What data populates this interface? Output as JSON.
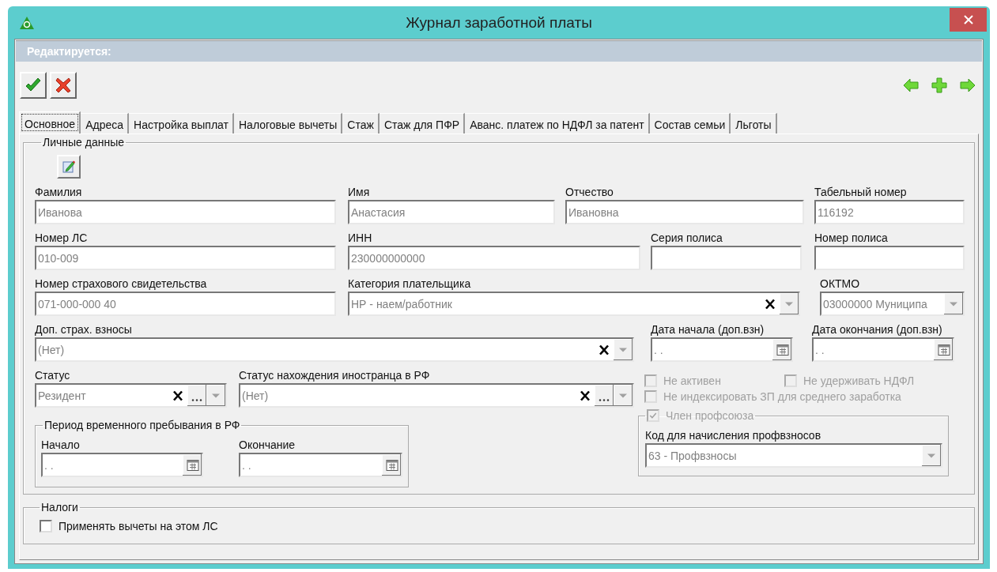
{
  "window": {
    "title": "Журнал заработной платы"
  },
  "edit_bar": {
    "label": "Редактируется:"
  },
  "tabs": [
    {
      "label": "Основное",
      "selected": true
    },
    {
      "label": "Адреса",
      "selected": false
    },
    {
      "label": "Настройка выплат",
      "selected": false
    },
    {
      "label": "Налоговые вычеты",
      "selected": false
    },
    {
      "label": "Стаж",
      "selected": false
    },
    {
      "label": "Стаж для ПФР",
      "selected": false
    },
    {
      "label": "Аванс. платеж по НДФЛ за патент",
      "selected": false
    },
    {
      "label": "Состав семьи",
      "selected": false
    },
    {
      "label": "Льготы",
      "selected": false
    }
  ],
  "personal": {
    "legend": "Личные данные",
    "fields": [
      {
        "label": "Фамилия",
        "value": "Иванова",
        "kind": "text"
      },
      {
        "label": "Имя",
        "value": "Анастасия",
        "kind": "text"
      },
      {
        "label": "Отчество",
        "value": "Ивановна",
        "kind": "text"
      },
      {
        "label": "Табельный номер",
        "value": "116192",
        "kind": "text"
      },
      {
        "label": "Номер ЛС",
        "value": "010-009",
        "kind": "text"
      },
      {
        "label": "ИНН",
        "value": "230000000000",
        "kind": "text"
      },
      {
        "label": "Серия полиса",
        "kind": "text"
      },
      {
        "label": "Номер полиса",
        "kind": "text"
      },
      {
        "label": "Номер страхового свидетельства",
        "value": "071-000-000 40",
        "kind": "text"
      },
      {
        "label": "Категория плательщика",
        "value": "НР - наем/работник",
        "kind": "combo",
        "clear": true,
        "ellipsis": false
      },
      {
        "label": "ОКТМО",
        "value": "03000000 Муниципа",
        "kind": "combo",
        "clear": false,
        "ellipsis": false
      },
      {
        "label": "Доп. страх. взносы",
        "value": "(Нет)",
        "kind": "combo",
        "clear": true,
        "ellipsis": false
      },
      {
        "label": "Дата начала (доп.взн)",
        "value": ". .",
        "kind": "date"
      },
      {
        "label": "Дата окончания (доп.взн)",
        "value": ". .",
        "kind": "date"
      },
      {
        "label": "Статус",
        "value": "Резидент",
        "kind": "combo",
        "clear": true,
        "ellipsis": true
      },
      {
        "label": "Статус нахождения иностранца в РФ",
        "value": "(Нет)",
        "kind": "combo",
        "clear": true,
        "ellipsis": true
      }
    ]
  },
  "stay_period": {
    "legend": "Период временного пребывания в РФ",
    "fields": [
      {
        "label": "Начало",
        "value": ". .",
        "kind": "date"
      },
      {
        "label": "Окончание",
        "value": ". .",
        "kind": "date"
      }
    ]
  },
  "flags": [
    {
      "label": "Не активен",
      "checked": false,
      "disabled": true
    },
    {
      "label": "Не удерживать НДФЛ",
      "checked": false,
      "disabled": true
    },
    {
      "label": "Не индексировать ЗП для среднего заработка",
      "checked": false,
      "disabled": true
    }
  ],
  "union": {
    "label": "Член профсоюза",
    "checked": true,
    "disabled": true,
    "field": {
      "label": "Код для начисления профвзносов",
      "value": "63 - Профвзносы",
      "kind": "combo",
      "clear": false,
      "ellipsis": false
    }
  },
  "taxes": {
    "legend": "Налоги",
    "checkbox": {
      "label": "Применять вычеты на этом ЛС",
      "checked": false,
      "disabled": false
    }
  }
}
